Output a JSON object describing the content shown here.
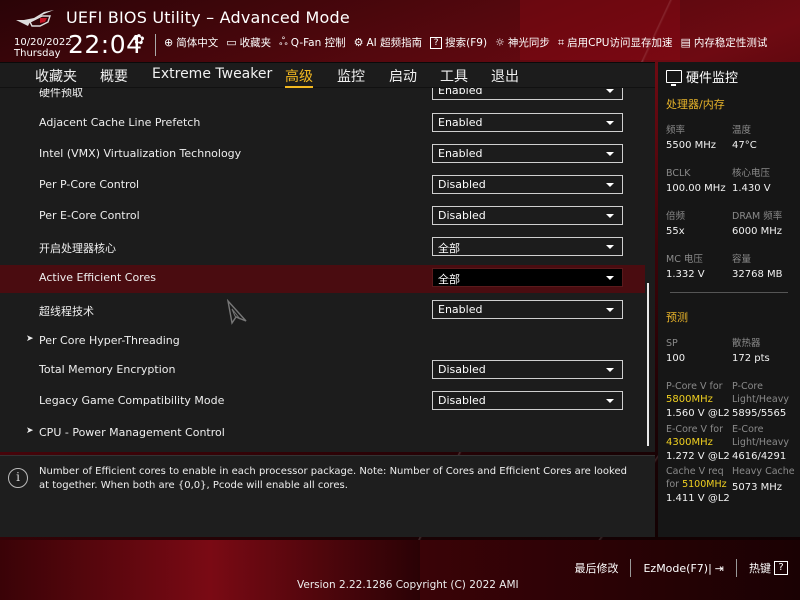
{
  "header": {
    "title": "UEFI BIOS Utility – Advanced Mode",
    "date": "10/20/2022",
    "day": "Thursday",
    "time": "22:04",
    "toolbar": [
      {
        "icon": "globe-icon",
        "glyph": "🌐",
        "label": "简体中文"
      },
      {
        "icon": "favorites-folder-icon",
        "glyph": "▭",
        "label": "收藏夹"
      },
      {
        "icon": "fan-icon",
        "glyph": "ᘛ",
        "label": "Q-Fan 控制"
      },
      {
        "icon": "ai-overclock-icon",
        "glyph": "⚙",
        "label": "AI 超频指南"
      },
      {
        "icon": "help-box-icon",
        "glyph": "?",
        "label": "搜索(F9)"
      },
      {
        "icon": "aura-light-icon",
        "glyph": "☼",
        "label": "神光同步"
      },
      {
        "icon": "resizable-bar-icon",
        "glyph": "⌗",
        "label": "启用CPU访问显存加速"
      },
      {
        "icon": "memory-test-icon",
        "glyph": "▤",
        "label": "内存稳定性测试"
      }
    ]
  },
  "tabs": [
    {
      "label": "收藏夹",
      "active": false
    },
    {
      "label": "概要",
      "active": false
    },
    {
      "label": "Extreme Tweaker",
      "active": false
    },
    {
      "label": "高级",
      "active": true
    },
    {
      "label": "监控",
      "active": false
    },
    {
      "label": "启动",
      "active": false
    },
    {
      "label": "工具",
      "active": false
    },
    {
      "label": "退出",
      "active": false
    }
  ],
  "settings": [
    {
      "label": "硬件预取",
      "value": "Enabled",
      "type": "select",
      "partial": true
    },
    {
      "label": "Adjacent Cache Line Prefetch",
      "value": "Enabled",
      "type": "select"
    },
    {
      "label": "Intel (VMX) Virtualization Technology",
      "value": "Enabled",
      "type": "select"
    },
    {
      "label": "Per P-Core Control",
      "value": "Disabled",
      "type": "select"
    },
    {
      "label": "Per E-Core Control",
      "value": "Disabled",
      "type": "select"
    },
    {
      "label": "开启处理器核心",
      "value": "全部",
      "type": "select"
    },
    {
      "label": "Active Efficient Cores",
      "value": "全部",
      "type": "select",
      "selected": true
    },
    {
      "label": "超线程技术",
      "value": "Enabled",
      "type": "select"
    },
    {
      "label": "Per Core Hyper-Threading",
      "type": "submenu"
    },
    {
      "label": "Total Memory Encryption",
      "value": "Disabled",
      "type": "select"
    },
    {
      "label": "Legacy Game Compatibility Mode",
      "value": "Disabled",
      "type": "select"
    },
    {
      "label": "CPU - Power Management Control",
      "type": "submenu"
    }
  ],
  "help": {
    "text": "Number of Efficient cores to enable in each processor package. Note: Number of Cores and Efficient Cores are looked at together. When both are {0,0}, Pcode will enable all cores."
  },
  "monitor": {
    "title": "硬件监控",
    "cpu_section": "处理器/内存",
    "cpu": [
      {
        "label": "频率",
        "value": "5500 MHz"
      },
      {
        "label": "温度",
        "value": "47°C"
      },
      {
        "label": "BCLK",
        "value": "100.00 MHz"
      },
      {
        "label": "核心电压",
        "value": "1.430 V"
      },
      {
        "label": "倍频",
        "value": "55x"
      },
      {
        "label": "DRAM 频率",
        "value": "6000 MHz"
      },
      {
        "label": "MC 电压",
        "value": "1.332 V"
      },
      {
        "label": "容量",
        "value": "32768 MB"
      }
    ],
    "predict_section": "预测",
    "predict": {
      "sp_label": "SP",
      "sp_value": "100",
      "cooler_label": "散热器",
      "cooler_value": "172 pts",
      "pcore_v_label": "P-Core V for",
      "pcore_v_freq": "5800MHz",
      "pcore_v_value": "1.560 V @L2",
      "pcore_lh_label1": "P-Core",
      "pcore_lh_label2": "Light/Heavy",
      "pcore_lh_value": "5895/5565",
      "ecore_v_label": "E-Core V for",
      "ecore_v_freq": "4300MHz",
      "ecore_v_value": "1.272 V @L2",
      "ecore_lh_label1": "E-Core",
      "ecore_lh_label2": "Light/Heavy",
      "ecore_lh_value": "4616/4291",
      "cache_v_label1": "Cache V req",
      "cache_v_label2": "for",
      "cache_v_freq": "5100MHz",
      "cache_v_value": "1.411 V @L2",
      "heavy_cache_label": "Heavy Cache",
      "heavy_cache_value": "5073 MHz"
    }
  },
  "footer": {
    "last_modified": "最后修改",
    "ezmode": "EzMode(F7)|",
    "hotkeys": "热键",
    "version": "Version 2.22.1286 Copyright (C) 2022 AMI"
  }
}
